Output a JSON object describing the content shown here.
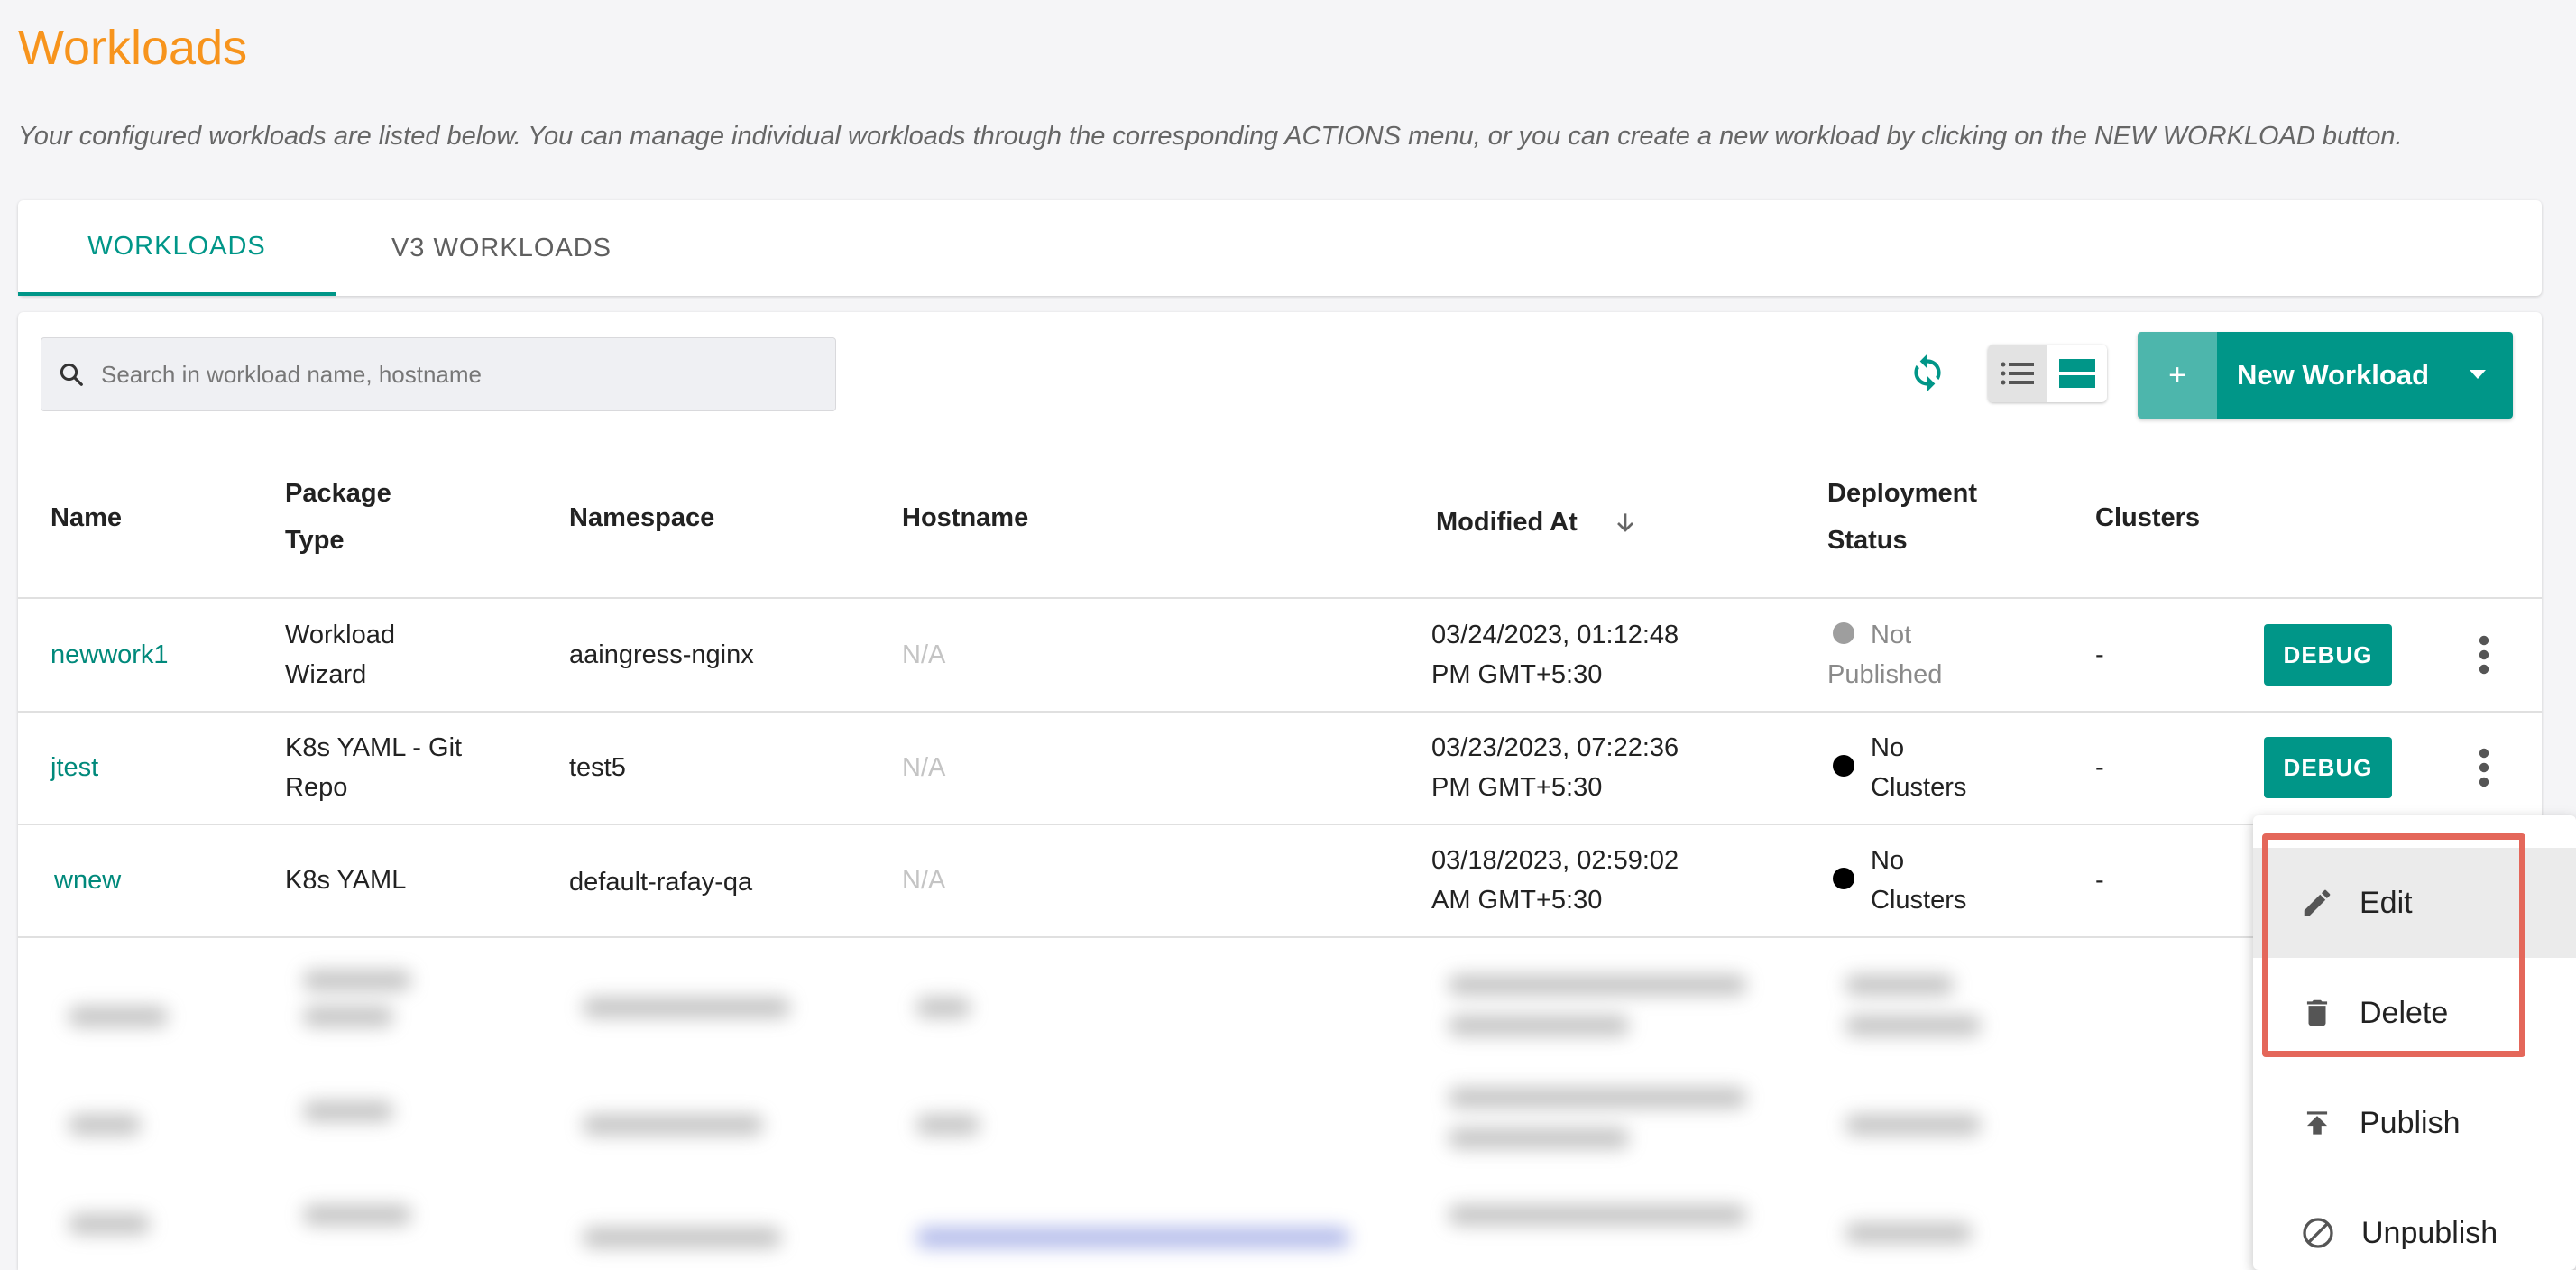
{
  "page": {
    "title": "Workloads",
    "description": "Your configured workloads are listed below. You can manage individual workloads through the corresponding ACTIONS menu, or you can create a new workload by clicking on the NEW WORKLOAD button."
  },
  "tabs": [
    {
      "label": "WORKLOADS",
      "active": true
    },
    {
      "label": "V3 WORKLOADS",
      "active": false
    }
  ],
  "toolbar": {
    "search_placeholder": "Search in workload name, hostname",
    "new_button_plus": "+",
    "new_button_label": "New Workload",
    "accent_color": "#009688"
  },
  "table": {
    "headers": {
      "name": "Name",
      "package_type_1": "Package",
      "package_type_2": "Type",
      "namespace": "Namespace",
      "hostname": "Hostname",
      "modified_at": "Modified At",
      "deployment_status_1": "Deployment",
      "deployment_status_2": "Status",
      "clusters": "Clusters"
    },
    "rows": [
      {
        "name": "newwork1",
        "package_1": "Workload",
        "package_2": "Wizard",
        "namespace": "aaingress-nginx",
        "hostname": "N/A",
        "modified_1": "03/24/2023, 01:12:48",
        "modified_2": "PM GMT+5:30",
        "status_1": "Not",
        "status_2": "Published",
        "status_color": "#9e9e9e",
        "clusters": "-",
        "debug_label": "DEBUG"
      },
      {
        "name": "jtest",
        "package_1": "K8s YAML - Git",
        "package_2": "Repo",
        "namespace": "test5",
        "hostname": "N/A",
        "modified_1": "03/23/2023, 07:22:36",
        "modified_2": "PM GMT+5:30",
        "status_1": "No",
        "status_2": "Clusters",
        "status_color": "#000000",
        "clusters": "-",
        "debug_label": "DEBUG"
      },
      {
        "name": "wnew",
        "package_1": "K8s YAML",
        "package_2": "",
        "namespace": "default-rafay-qa",
        "hostname": "N/A",
        "modified_1": "03/18/2023, 02:59:02",
        "modified_2": "AM GMT+5:30",
        "status_1": "No",
        "status_2": "Clusters",
        "status_color": "#000000",
        "clusters": "-"
      }
    ]
  },
  "actions_menu": {
    "items": [
      {
        "label": "Edit",
        "icon": "pencil-icon"
      },
      {
        "label": "Delete",
        "icon": "trash-icon"
      },
      {
        "label": "Publish",
        "icon": "publish-icon"
      },
      {
        "label": "Unpublish",
        "icon": "block-icon"
      }
    ],
    "highlight_color": "#e4675a"
  }
}
